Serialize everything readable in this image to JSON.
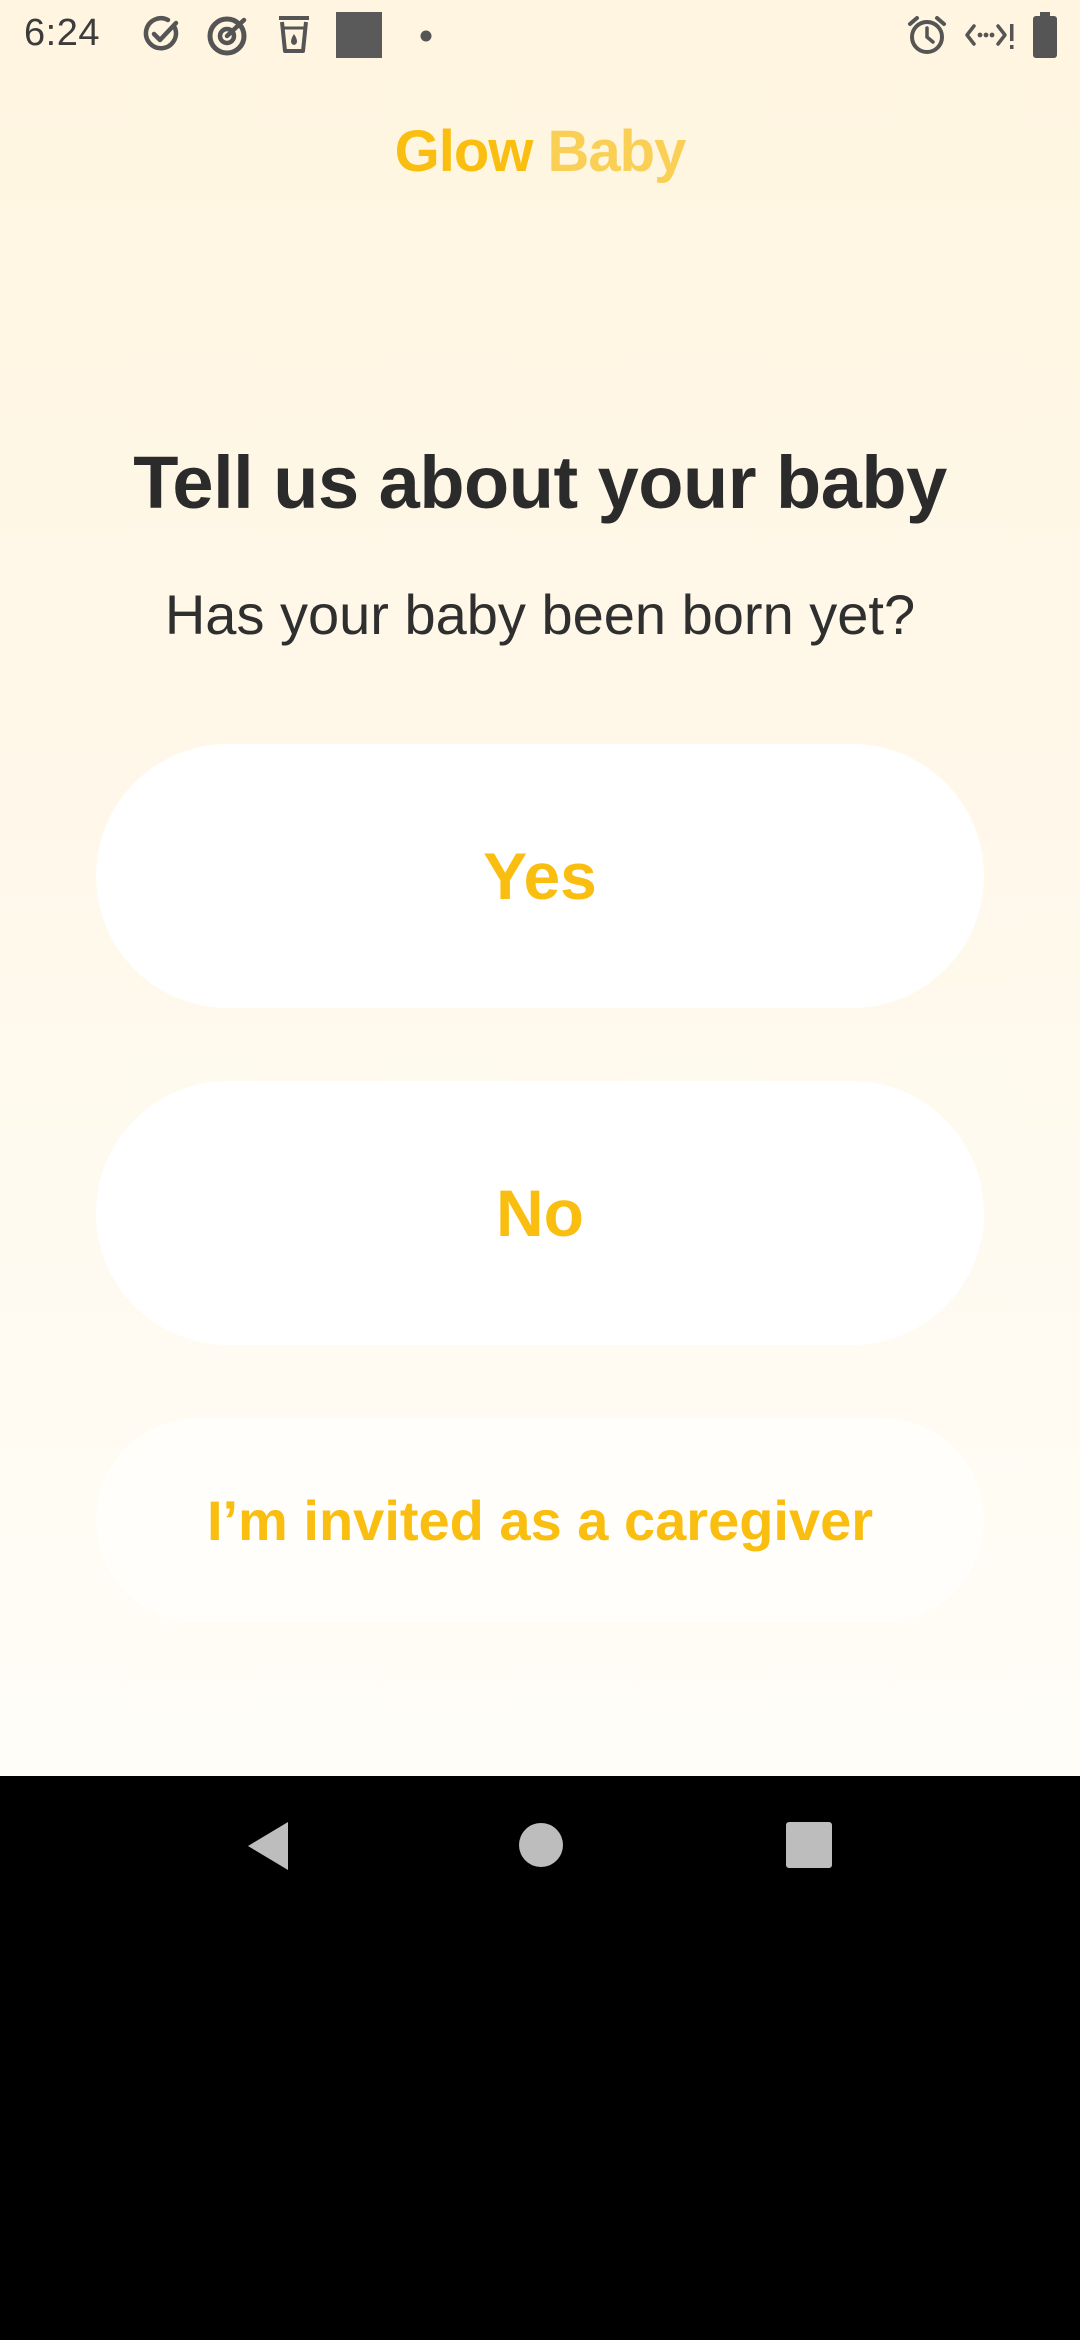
{
  "status_bar": {
    "time": "6:24",
    "icons": [
      "check-circle-icon",
      "target-icon",
      "cup-icon",
      "square-notification-icon",
      "dot-icon",
      "alarm-icon",
      "data-arrows-icon",
      "battery-icon"
    ]
  },
  "logo": {
    "part1": "Glow",
    "part2": "Baby",
    "colors": {
      "glow": "#f9be0f",
      "baby": "#f9cf55"
    }
  },
  "onboarding": {
    "title": "Tell us about your baby",
    "question": "Has your baby been born yet?",
    "options": {
      "yes": "Yes",
      "no": "No",
      "caregiver": "I’m invited as a caregiver"
    }
  },
  "nav": {
    "icons": [
      "back-icon",
      "home-icon",
      "recents-icon"
    ]
  },
  "colors": {
    "accent": "#f9be0f",
    "title_text": "#2b2b2b",
    "background_top": "#fff5e0",
    "background_bottom": "#fffdf8"
  }
}
